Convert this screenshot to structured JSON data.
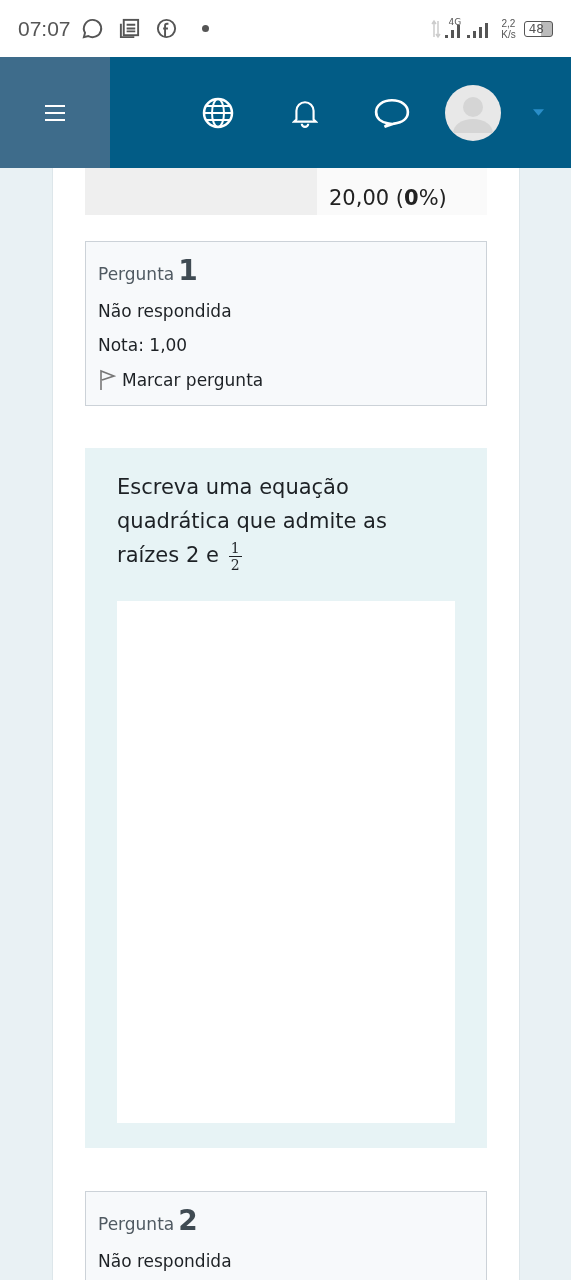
{
  "status_bar": {
    "time": "07:07",
    "network": "4G",
    "speed": "2,2",
    "speed_unit": "K/s",
    "battery": "48"
  },
  "summary": {
    "value": "20,00 (**0**%)"
  },
  "questions": [
    {
      "label": "Pergunta",
      "number": "1",
      "state": "Não respondida",
      "grade": "Nota: 1,00",
      "flag": "Marcar pergunta",
      "text": "Escreva uma equação quadrática que admite as raízes 2 e",
      "fraction": {
        "numerator": "1",
        "denominator": "2"
      }
    },
    {
      "label": "Pergunta",
      "number": "2",
      "state": "Não respondida"
    }
  ]
}
